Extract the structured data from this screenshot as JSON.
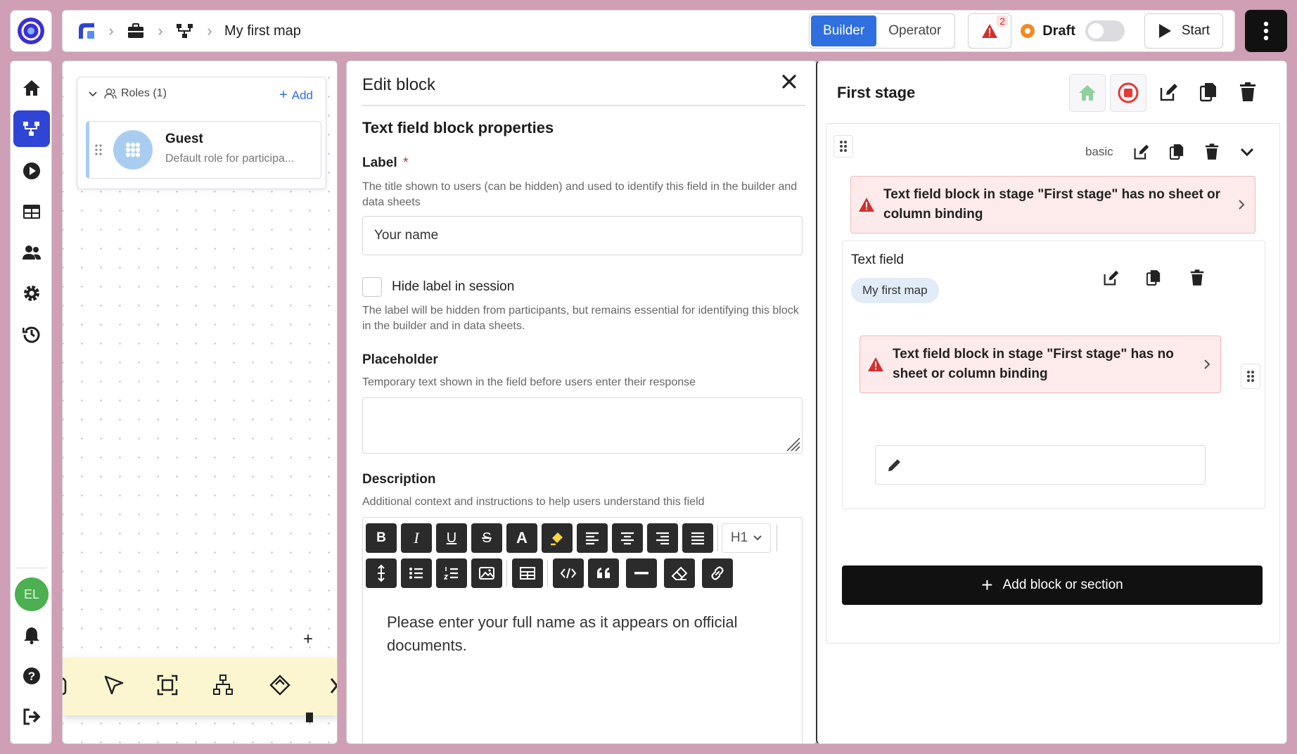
{
  "topbar": {
    "map_title": "My first map",
    "modes": [
      "Builder",
      "Operator"
    ],
    "active_mode": "Builder",
    "warning_count": "2",
    "status_label": "Draft",
    "start_label": "Start"
  },
  "sidebar": {
    "items": [
      "home-icon",
      "map-icon",
      "play-icon",
      "table-icon",
      "users-icon",
      "gear-icon",
      "history-icon"
    ],
    "avatar_initials": "EL"
  },
  "canvas": {
    "roles_title": "Roles (1)",
    "add_label": "Add",
    "role": {
      "name": "Guest",
      "description": "Default role for participa..."
    }
  },
  "edit_block": {
    "title": "Edit block",
    "section_title": "Text field block properties",
    "label": {
      "title": "Label",
      "required_mark": "*",
      "help": "The title shown to users (can be hidden) and used to identify this field in the builder and data sheets",
      "value": "Your name"
    },
    "hide_label": {
      "title": "Hide label in session",
      "help": "The label will be hidden from participants, but remains essential for identifying this block in the builder and in data sheets."
    },
    "placeholder": {
      "title": "Placeholder",
      "help": "Temporary text shown in the field before users enter their response",
      "value": ""
    },
    "description": {
      "title": "Description",
      "help": "Additional context and instructions to help users understand this field",
      "heading_select": "H1",
      "content": "Please enter your full name as it appears on official documents."
    }
  },
  "stage": {
    "title": "First stage",
    "section_tag": "basic",
    "warning_1": "Text field block in stage \"First stage\" has no sheet or column binding",
    "block_title": "Text field",
    "block_chip": "My first map",
    "warning_2": "Text field block in stage \"First stage\" has no sheet or column binding",
    "add_button": "Add block or section"
  },
  "colors": {
    "background": "#cf9fb5",
    "accent": "#2f6fe0",
    "sidebar_active": "#2f45d6",
    "warning_bg": "#fdeaea",
    "warning_icon": "#d32f2f"
  }
}
